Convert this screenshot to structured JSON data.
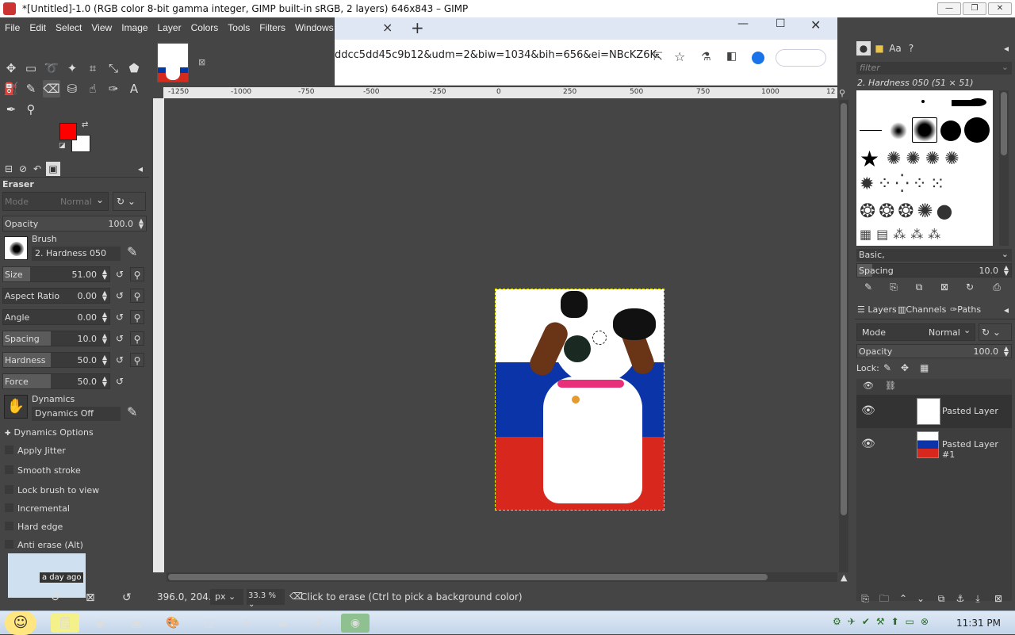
{
  "window": {
    "title": "*[Untitled]-1.0 (RGB color 8-bit gamma integer, GIMP built-in sRGB, 2 layers) 646x843 – GIMP"
  },
  "menu": [
    "File",
    "Edit",
    "Select",
    "View",
    "Image",
    "Layer",
    "Colors",
    "Tools",
    "Filters",
    "Windows"
  ],
  "browser": {
    "url": "ddcc5dd45c9b12&udm=2&biw=1034&bih=656&ei=NBcKZ6K...",
    "new_tab": "+",
    "close_tab": "×"
  },
  "colors": {
    "foreground": "#ff0000",
    "background": "#ffffff",
    "accent": "#5a5a5a"
  },
  "tool_options": {
    "title": "Eraser",
    "mode_label": "Mode",
    "mode_value": "Normal",
    "opacity": {
      "label": "Opacity",
      "value": "100.0",
      "fraction": 1.0
    },
    "brush_label": "Brush",
    "brush_name": "2. Hardness 050",
    "size": {
      "label": "Size",
      "value": "51.00",
      "fraction": 0.25
    },
    "aspect": {
      "label": "Aspect Ratio",
      "value": "0.00",
      "fraction": 0.5
    },
    "angle": {
      "label": "Angle",
      "value": "0.00",
      "fraction": 0.5
    },
    "spacing": {
      "label": "Spacing",
      "value": "10.0",
      "fraction": 0.1
    },
    "hardness": {
      "label": "Hardness",
      "value": "50.0",
      "fraction": 0.5
    },
    "force": {
      "label": "Force",
      "value": "50.0",
      "fraction": 0.5
    },
    "dynamics_label": "Dynamics",
    "dynamics_value": "Dynamics Off",
    "dynamics_options": "Dynamics Options",
    "apply_jitter": "Apply Jitter",
    "smooth_stroke": "Smooth stroke",
    "lock_brush": "Lock brush to view",
    "incremental": "Incremental",
    "hard_edge": "Hard edge",
    "anti_erase": "Anti erase  (Alt)",
    "history_label": "a day ago"
  },
  "ruler": {
    "ticks": [
      "-1250",
      "-1000",
      "-750",
      "-500",
      "-250",
      "0",
      "250",
      "500",
      "750",
      "1000",
      "12"
    ]
  },
  "status": {
    "coords": "396.0, 204.0",
    "unit": "px",
    "zoom": "33.3 %",
    "message": "Click to erase (Ctrl to pick a background color)"
  },
  "brushes": {
    "filter_placeholder": "filter",
    "current": "2. Hardness 050 (51 × 51)",
    "tag": "Basic,",
    "spacing_label": "Spacing",
    "spacing_value": "10.0"
  },
  "layers": {
    "tabs": [
      "Layers",
      "Channels",
      "Paths"
    ],
    "mode_label": "Mode",
    "mode_value": "Normal",
    "opacity_label": "Opacity",
    "opacity_value": "100.0",
    "lock_label": "Lock:",
    "items": [
      "Pasted Layer",
      "Pasted Layer #1"
    ]
  },
  "taskbar": {
    "clock": "11:31 PM"
  }
}
